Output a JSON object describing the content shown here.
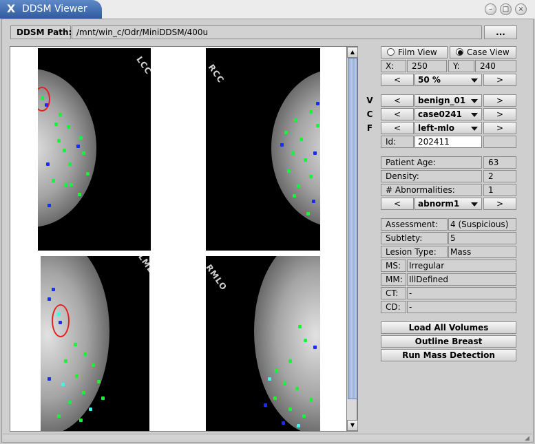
{
  "window": {
    "title": "DDSM Viewer",
    "app_icon": "X"
  },
  "path_row": {
    "label": "DDSM Path:",
    "value": "/mnt/win_c/Odr/MiniDDSM/400u",
    "browse_label": "..."
  },
  "view_mode": {
    "film_label": "Film View",
    "case_label": "Case View",
    "selected": "Case View"
  },
  "coords": {
    "x_label": "X:",
    "x_value": "250",
    "y_label": "Y:",
    "y_value": "240"
  },
  "zoom": {
    "prev": "<",
    "value": "50 %",
    "next": ">"
  },
  "nav_rows": [
    {
      "letter": "V",
      "prev": "<",
      "value": "benign_01",
      "next": ">"
    },
    {
      "letter": "C",
      "prev": "<",
      "value": "case0241",
      "next": ">"
    },
    {
      "letter": "F",
      "prev": "<",
      "value": "left-mlo",
      "next": ">"
    }
  ],
  "id_row": {
    "label": "Id:",
    "value": "202411"
  },
  "patient": {
    "age_label": "Patient Age:",
    "age_value": "63",
    "density_label": "Density:",
    "density_value": "2",
    "abn_label": "# Abnormalities:",
    "abn_value": "1"
  },
  "abnorm_select": {
    "prev": "<",
    "value": "abnorm1",
    "next": ">"
  },
  "details": [
    {
      "label": "Assessment:",
      "value": "4 (Suspicious)"
    },
    {
      "label": "Subtlety:",
      "value": "5"
    },
    {
      "label": "Lesion Type:",
      "value": "Mass"
    },
    {
      "label": "MS:",
      "value": "Irregular"
    },
    {
      "label": "MM:",
      "value": "IllDefined"
    },
    {
      "label": "CT:",
      "value": "-"
    },
    {
      "label": "CD:",
      "value": "-"
    }
  ],
  "actions": {
    "load": "Load All Volumes",
    "outline": "Outline Breast",
    "detect": "Run Mass Detection"
  },
  "view_labels": {
    "lcc": "LCC",
    "rcc": "RCC",
    "lmlo": "LMLO",
    "rmlo": "RMLO"
  },
  "scrollbar": {
    "up": "▲",
    "down": "▼"
  },
  "title_buttons": {
    "minimize": "–",
    "maximize": "□",
    "close": "×"
  },
  "colors": {
    "title_bar": "#3c6bb0",
    "detection_green": "#19f23a",
    "detection_blue": "#1a2cf0",
    "lesion_outline": "#e32020"
  }
}
